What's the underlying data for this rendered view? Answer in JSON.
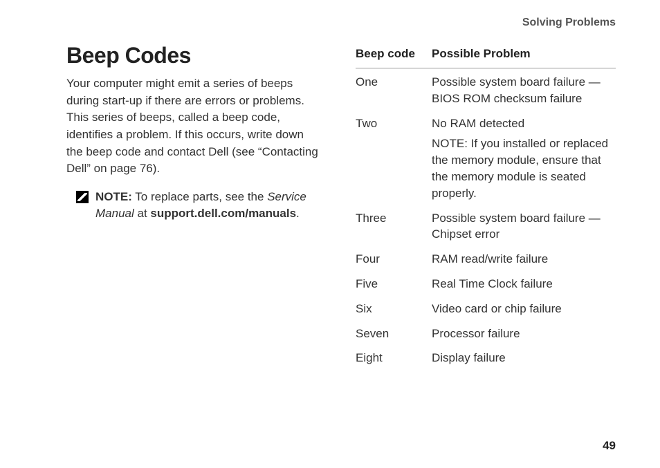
{
  "header": {
    "title": "Solving Problems"
  },
  "section": {
    "title": "Beep Codes",
    "intro": "Your computer might emit a series of beeps during start-up if there are errors or problems. This series of beeps, called a beep code, identifies a problem. If this occurs, write down the beep code and contact Dell (see “Contacting Dell” on page 76)."
  },
  "note": {
    "label": "NOTE:",
    "text_before": " To replace parts, see the ",
    "service_manual": "Service Manual",
    "text_mid": " at ",
    "url": "support.dell.com/manuals",
    "text_after": "."
  },
  "table": {
    "headers": {
      "code": "Beep code",
      "problem": "Possible Problem"
    },
    "rows": [
      {
        "code": "One",
        "problem": "Possible system board failure — BIOS ROM checksum failure",
        "note_label": "",
        "note_text": ""
      },
      {
        "code": "Two",
        "problem": "No RAM detected",
        "note_label": "NOTE:",
        "note_text": " If you installed or replaced the memory module, ensure that the memory module is seated properly."
      },
      {
        "code": "Three",
        "problem": "Possible system board failure — Chipset error",
        "note_label": "",
        "note_text": ""
      },
      {
        "code": "Four",
        "problem": "RAM read/write failure",
        "note_label": "",
        "note_text": ""
      },
      {
        "code": "Five",
        "problem": "Real Time Clock failure",
        "note_label": "",
        "note_text": ""
      },
      {
        "code": "Six",
        "problem": "Video card or chip failure",
        "note_label": "",
        "note_text": ""
      },
      {
        "code": "Seven",
        "problem": "Processor failure",
        "note_label": "",
        "note_text": ""
      },
      {
        "code": "Eight",
        "problem": "Display failure",
        "note_label": "",
        "note_text": ""
      }
    ]
  },
  "page_number": "49"
}
